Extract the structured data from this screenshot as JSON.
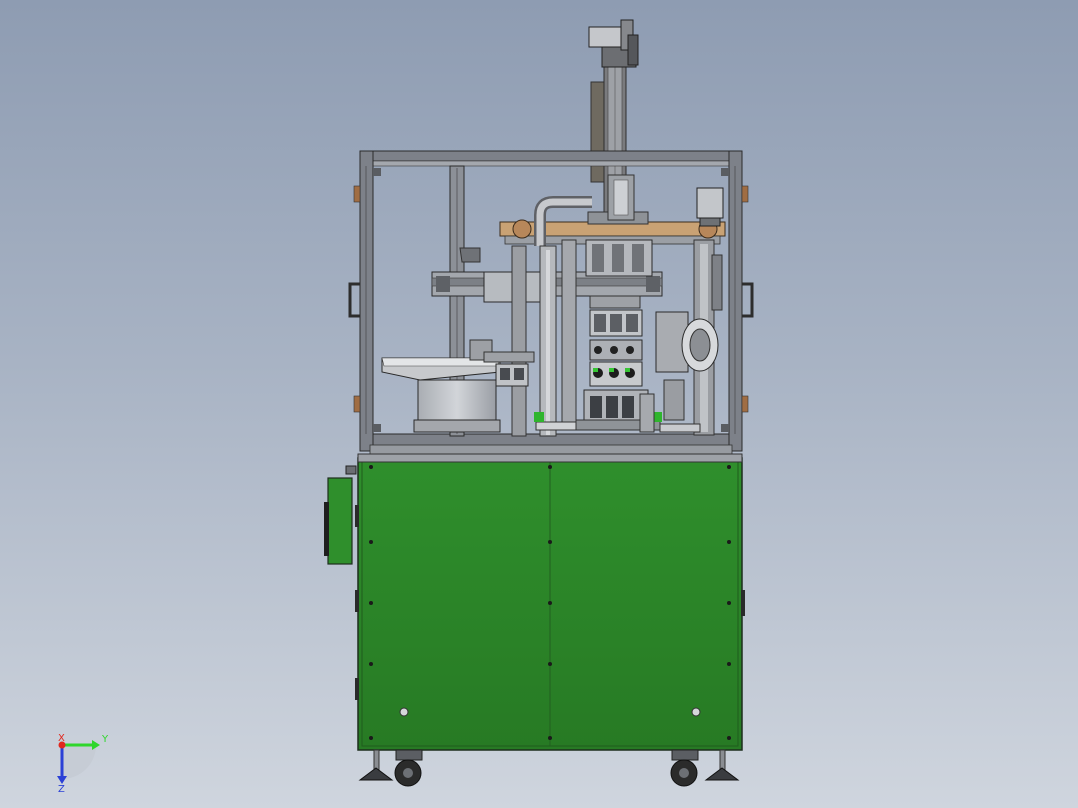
{
  "viewport": {
    "background_top": "#8e9cb2",
    "background_bottom": "#cfd5de"
  },
  "machine": {
    "cabinet_color": "#2d8a2a",
    "frame_color": "#7d8189",
    "component_color": "#b9bcc1",
    "accent_brown": "#b7875a",
    "caster_color": "#2b2b2b"
  },
  "triad": {
    "x_label": "X",
    "y_label": "Y",
    "z_label": "Z",
    "x_color": "#e0281e",
    "y_color": "#2fd62c",
    "z_color": "#2b40d6"
  }
}
